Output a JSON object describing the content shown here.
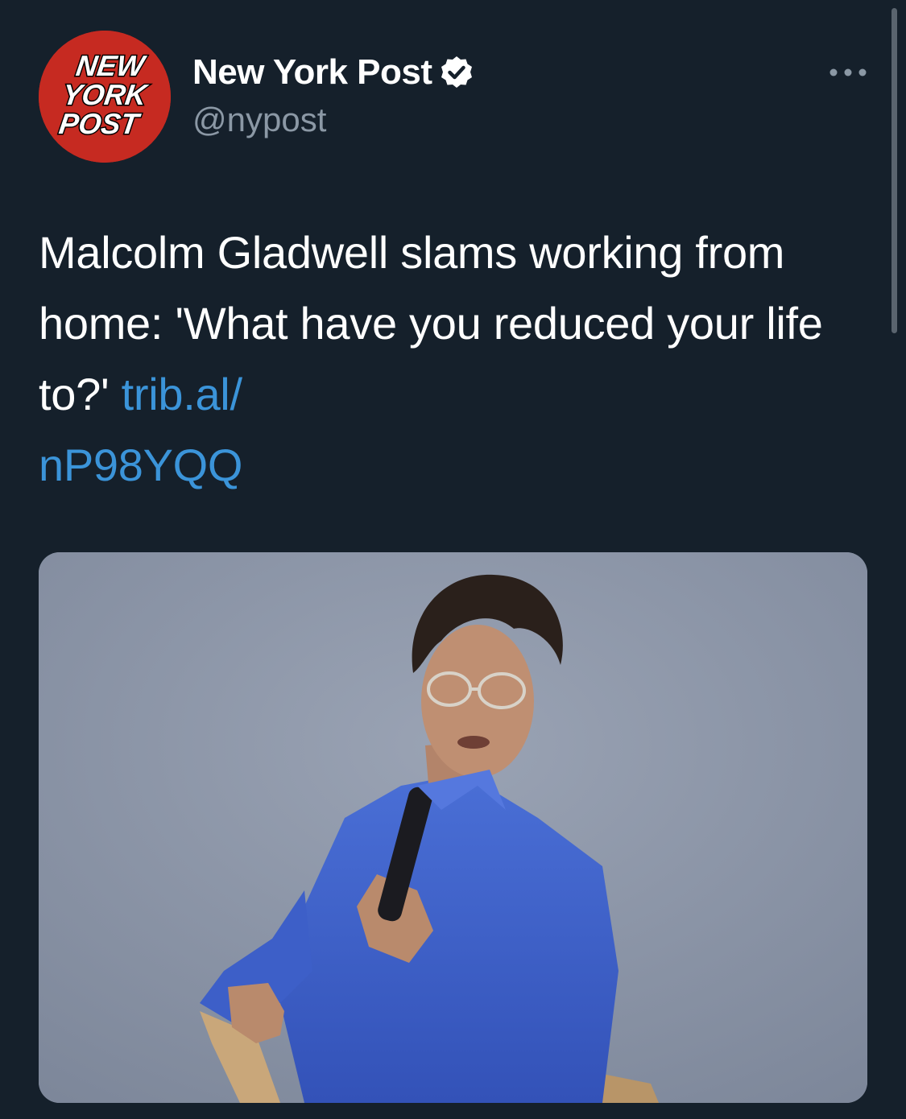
{
  "tweet": {
    "author": {
      "display_name": "New York Post",
      "handle": "@nypost",
      "verified": true,
      "avatar_logo_lines": [
        "NEW",
        "YORK",
        "POST"
      ]
    },
    "text": {
      "headline": "Malcolm Gladwell slams working from home: 'What have you reduced your life to?'",
      "link_line1": "trib.al/",
      "link_line2": "nP98YQQ"
    },
    "media": {
      "type": "photo"
    }
  },
  "icons": {
    "more": "more-horizontal-icon",
    "verified": "verified-badge-icon"
  },
  "colors": {
    "background": "#15202b",
    "link": "#3b94d9",
    "secondary_text": "#8b98a5",
    "brand_red": "#c62a21"
  }
}
